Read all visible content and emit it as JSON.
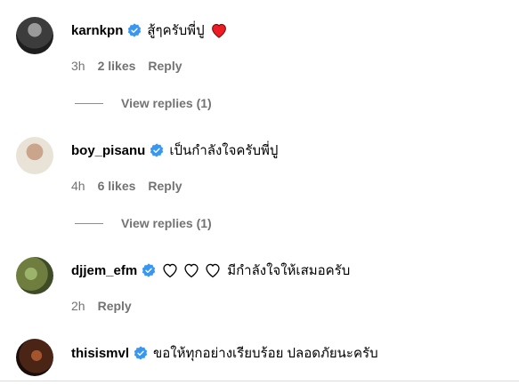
{
  "comments": [
    {
      "username": "karnkpn",
      "text": "สู้ๆครับพี่ปู",
      "emoji": "red-heart",
      "time": "3h",
      "likes": "2 likes",
      "reply": "Reply",
      "view_replies": "View replies (1)"
    },
    {
      "username": "boy_pisanu",
      "text": "เป็นกำลังใจครับพี่ปู",
      "time": "4h",
      "likes": "6 likes",
      "reply": "Reply",
      "view_replies": "View replies (1)"
    },
    {
      "username": "djjem_efm",
      "text": "มีกำลังใจให้เสมอครับ",
      "emoji": "three-outline-hearts",
      "time": "2h",
      "reply": "Reply"
    },
    {
      "username": "thisismvl",
      "text": "ขอให้ทุกอย่างเรียบร้อย ปลอดภัยนะครับ"
    }
  ],
  "colors": {
    "verified": "#3897f0",
    "meta": "#737373",
    "heart": "#ed1c24"
  }
}
